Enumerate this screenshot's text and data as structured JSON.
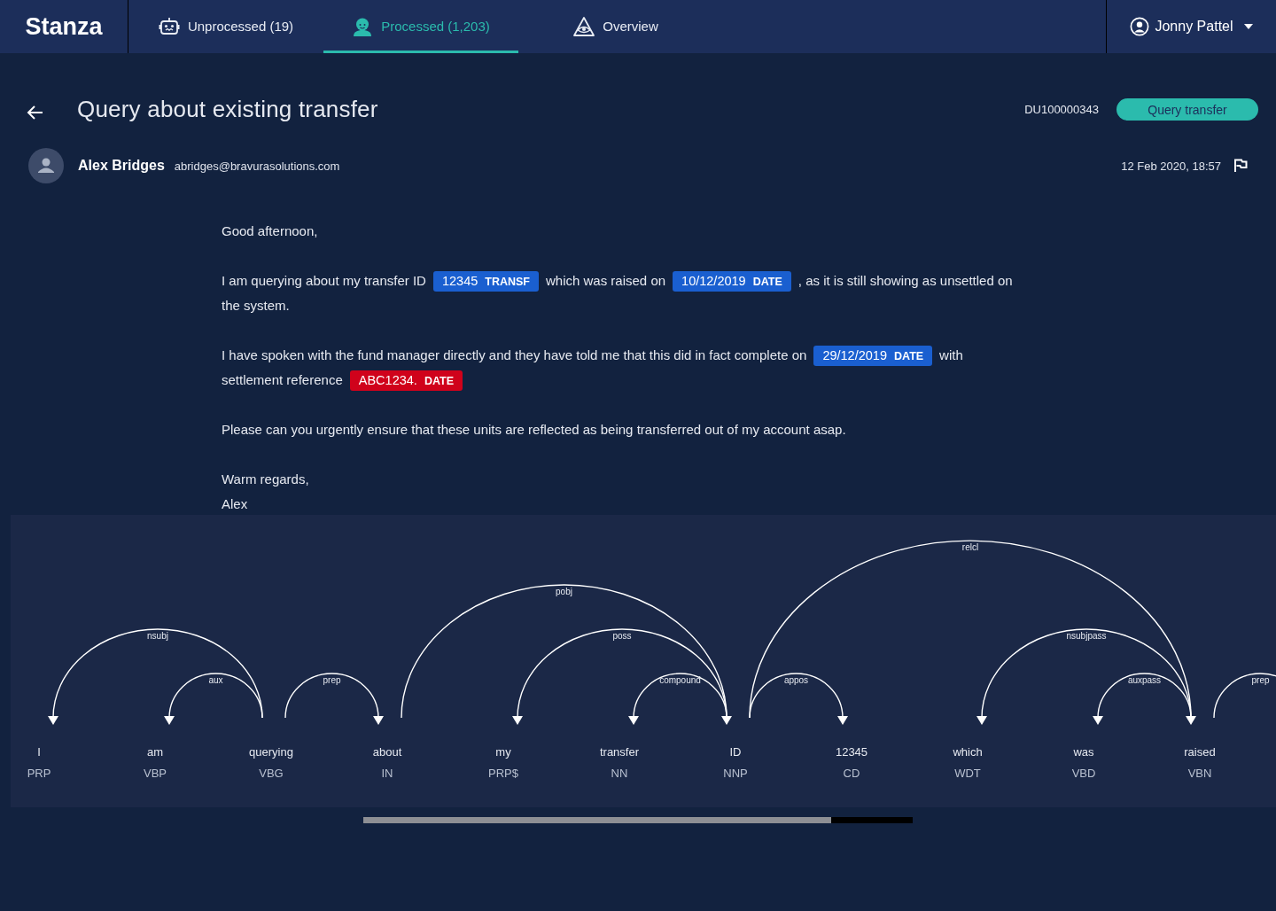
{
  "app": {
    "logo": "Stanza"
  },
  "tabs": [
    {
      "label": "Unprocessed (19)",
      "selected": false
    },
    {
      "label": "Processed (1,203)",
      "selected": true
    },
    {
      "label": "Overview",
      "selected": false
    }
  ],
  "user": {
    "name": "Jonny Pattel"
  },
  "message": {
    "title": "Query about existing transfer",
    "reference": "DU100000343",
    "category_button": "Query transfer",
    "sender_name": "Alex Bridges",
    "sender_email": "abridges@bravurasolutions.com",
    "date": "12 Feb 2020, 18:57"
  },
  "body": [
    [
      {
        "kind": "text",
        "text": "Good afternoon,"
      }
    ],
    [
      {
        "kind": "text",
        "text": "I am querying about my transfer ID"
      },
      {
        "kind": "entity",
        "text": "12345",
        "label": "TRANSF",
        "color": "#1a5fd0"
      },
      {
        "kind": "text",
        "text": "which was raised on"
      },
      {
        "kind": "entity",
        "text": "10/12/2019",
        "label": "DATE",
        "color": "#1a5fd0"
      },
      {
        "kind": "text",
        "text": ", as it is still showing as unsettled on"
      },
      {
        "kind": "break"
      },
      {
        "kind": "text",
        "text": "the system."
      }
    ],
    [
      {
        "kind": "text",
        "text": "I have spoken with the fund manager directly and they have told me that this did in fact complete on"
      },
      {
        "kind": "entity",
        "text": "29/12/2019",
        "label": "DATE",
        "color": "#1a5fd0"
      },
      {
        "kind": "text",
        "text": "with"
      },
      {
        "kind": "break"
      },
      {
        "kind": "text",
        "text": "settlement reference"
      },
      {
        "kind": "entity",
        "text": "ABC1234.",
        "label": "DATE",
        "color": "#d0021b"
      }
    ],
    [
      {
        "kind": "text",
        "text": "Please can you urgently ensure that these units are reflected as being transferred out of my account asap."
      }
    ],
    [
      {
        "kind": "text",
        "text": "Warm regards,"
      },
      {
        "kind": "break"
      },
      {
        "kind": "text",
        "text": "Alex"
      }
    ]
  ],
  "parse": {
    "tokens": [
      {
        "text": "I",
        "tag": "PRP"
      },
      {
        "text": "am",
        "tag": "VBP"
      },
      {
        "text": "querying",
        "tag": "VBG"
      },
      {
        "text": "about",
        "tag": "IN"
      },
      {
        "text": "my",
        "tag": "PRP$"
      },
      {
        "text": "transfer",
        "tag": "NN"
      },
      {
        "text": "ID",
        "tag": "NNP"
      },
      {
        "text": "12345",
        "tag": "CD"
      },
      {
        "text": "which",
        "tag": "WDT"
      },
      {
        "text": "was",
        "tag": "VBD"
      },
      {
        "text": "raised",
        "tag": "VBN"
      }
    ],
    "arcs": [
      {
        "label": "nsubj"
      },
      {
        "label": "aux"
      },
      {
        "label": "prep"
      },
      {
        "label": "pobj"
      },
      {
        "label": "poss"
      },
      {
        "label": "compound"
      },
      {
        "label": "appos"
      },
      {
        "label": "relcl"
      },
      {
        "label": "nsubjpass"
      },
      {
        "label": "auxpass"
      },
      {
        "label": "prep"
      }
    ]
  }
}
